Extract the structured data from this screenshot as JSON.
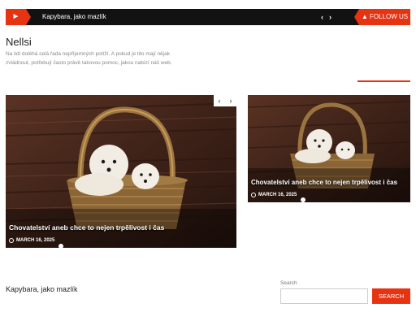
{
  "ticker": {
    "icon": "bullhorn-icon",
    "headline": "Kapybara, jako mazlík",
    "prev_label": "‹",
    "next_label": "›",
    "follow_label": "FOLLOW US",
    "follow_icon": "thumbs-up-icon"
  },
  "site": {
    "title": "Nellsi",
    "description": "Na lidi doléhá celá řada nepříjemných potíží. A pokud je tito mají nějak zvládnout, potřebují často právě takovou pomoc, jakou nabízí náš web."
  },
  "slider": {
    "prev_label": "‹",
    "next_label": "›",
    "slides": [
      {
        "title": "Chovatelství aneb chce to nejen trpělivost i čas",
        "date": "MARCH 16, 2025"
      },
      {
        "title": "Chovatelství aneb chce to nejen trpělivost i čas",
        "date": "MARCH 16, 2025"
      }
    ]
  },
  "footer": {
    "post_title": "Kapybara, jako mazlík",
    "search_label": "Search",
    "search_value": "",
    "search_button": "SEARCH"
  },
  "colors": {
    "accent": "#e63312",
    "bar": "#121212"
  }
}
